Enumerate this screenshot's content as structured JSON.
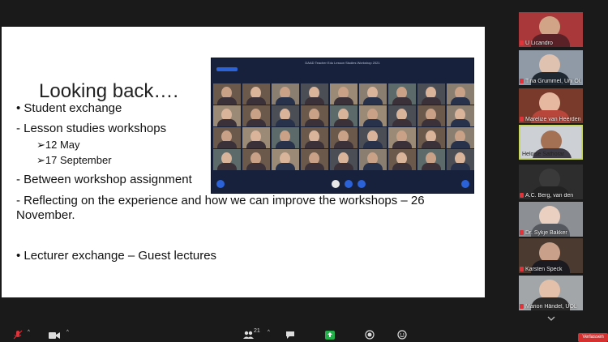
{
  "slide": {
    "title": "Looking back….",
    "bullets": {
      "student_exchange": "• Student exchange",
      "lesson_workshops": "- Lesson studies workshops",
      "date1": "➢12 May",
      "date2": "➢17 September",
      "between": "- Between workshop assignment",
      "reflecting": "- Reflecting on the experience and how we can improve the workshops – 26 November.",
      "lecturer": "• Lecturer exchange – Guest lectures"
    }
  },
  "embedded_screenshot": {
    "title": "DAAD Teacher Edu Lesson Studies Workshop 2021"
  },
  "participants": [
    {
      "name": "U Licandro"
    },
    {
      "name": "Tina Grummel, Uni Ol..."
    },
    {
      "name": "Marelize van Heerden"
    },
    {
      "name": "Heloise Sathorar"
    },
    {
      "name": "A.C. Berg, van den"
    },
    {
      "name": "Dr. Sykje Bakker"
    },
    {
      "name": "Karsten Speck"
    },
    {
      "name": "Marion Händel, UOL"
    }
  ],
  "toolbar": {
    "participants_count": "21",
    "leave_label": "Verlassen"
  },
  "colors": {
    "background": "#1a1a1a",
    "active_speaker_border": "#c9d85a",
    "leave_red": "#d4302f",
    "share_green": "#23b04b",
    "mute_red": "#e2333a"
  }
}
